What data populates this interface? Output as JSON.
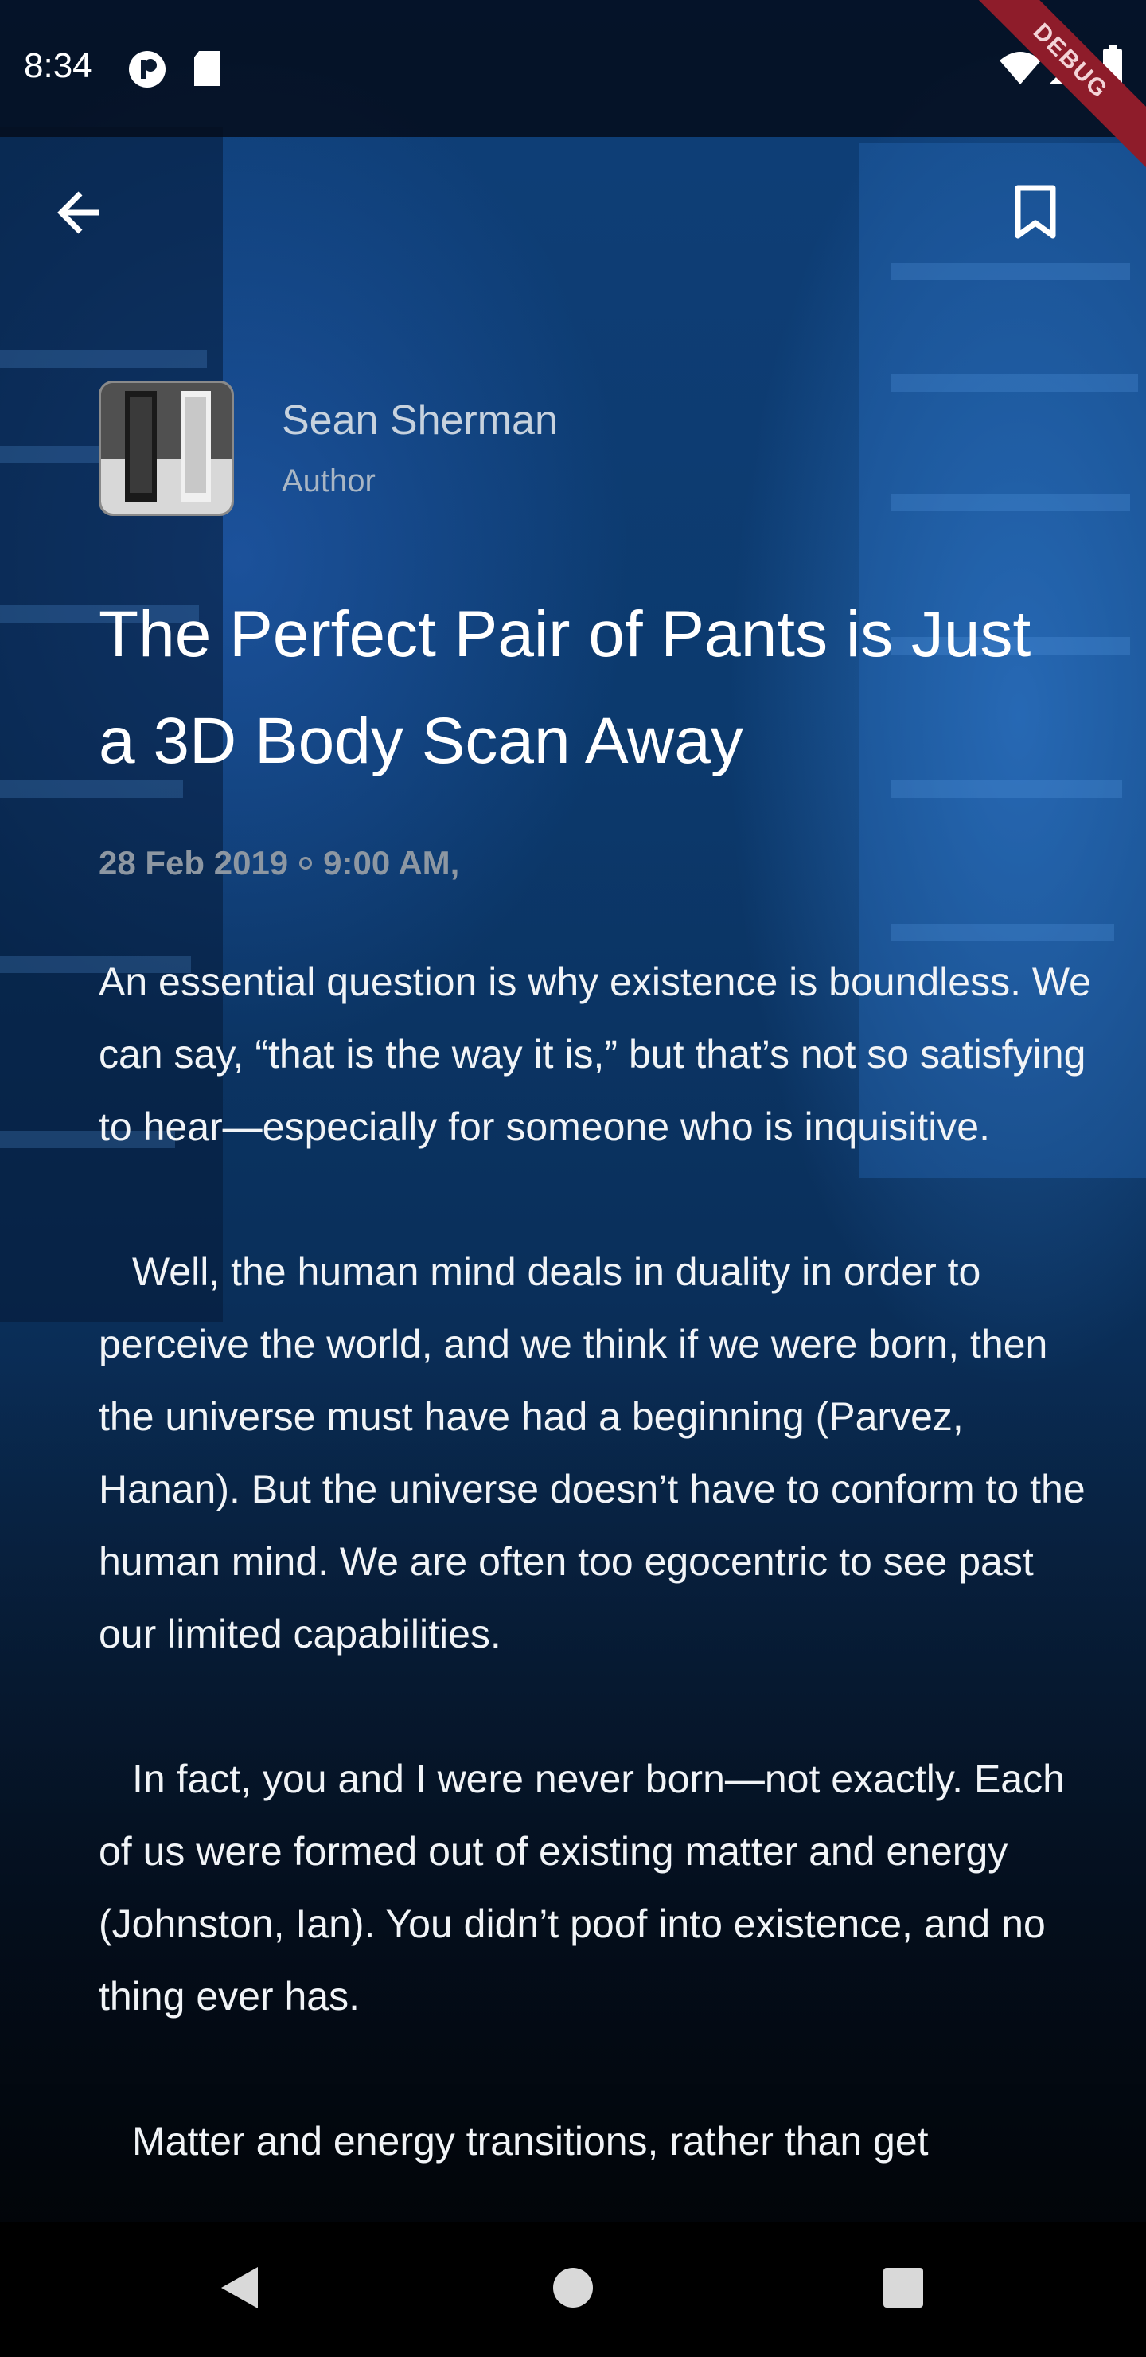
{
  "status_bar": {
    "time": "8:34",
    "icons": [
      "cast-icon",
      "sd-card-icon",
      "wifi-icon",
      "signal-icon",
      "battery-icon"
    ]
  },
  "debug_banner": "DEBUG",
  "app_bar": {
    "back_icon": "back-arrow-icon",
    "bookmark_icon": "bookmark-icon"
  },
  "author": {
    "name": "Sean Sherman",
    "role": "Author"
  },
  "article": {
    "title": "The Perfect Pair of Pants is Just a 3D Body Scan Away",
    "date": "28 Feb 2019",
    "time": "9:00 AM,",
    "paragraphs": [
      "An essential question is why existence is boundless. We can say, “that is the way it is,” but that’s not so satisfying to hear—especially for someone who is inquisitive.",
      "Well, the human mind deals in duality in order to perceive the world, and we think if we were born, then the universe must have had a beginning (Parvez, Hanan). But the universe doesn’t have to conform to the human mind. We are often too egocentric to see past our limited capabilities.",
      "In fact, you and I were never born—not exactly. Each of us were formed out of existing matter and energy (Johnston, Ian). You didn’t poof into existence, and no thing ever has.",
      "Matter and energy transitions, rather than get"
    ]
  },
  "nav_bar": {
    "back": "nav-back-icon",
    "home": "nav-home-icon",
    "recents": "nav-recents-icon"
  },
  "colors": {
    "background_top": "#0f3f78",
    "background_bottom": "#03070d",
    "debug_banner": "#8e1c2a",
    "meta_text": "#8d97a2"
  }
}
